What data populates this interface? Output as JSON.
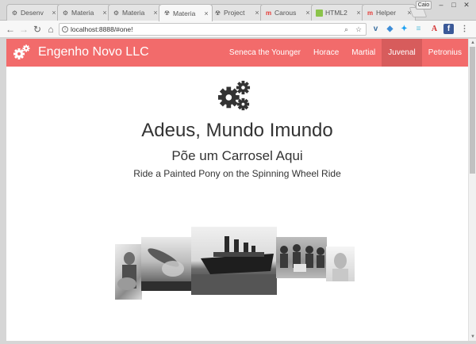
{
  "browser": {
    "tabs": [
      {
        "label": "Desenv",
        "icon": "gear-icon",
        "active": false
      },
      {
        "label": "Materia",
        "icon": "gear-icon",
        "active": false
      },
      {
        "label": "Materia",
        "icon": "gear-icon",
        "active": false
      },
      {
        "label": "Materia",
        "icon": "radiation-icon",
        "active": true
      },
      {
        "label": "Project",
        "icon": "radiation-icon",
        "active": false
      },
      {
        "label": "Carous",
        "icon": "brand-m-icon",
        "active": false
      },
      {
        "label": "HTML2",
        "icon": "html-doc-icon",
        "active": false
      },
      {
        "label": "Helper",
        "icon": "brand-m-icon",
        "active": false
      }
    ],
    "close_glyph": "×",
    "profile_label": "Caio",
    "address": "localhost:8888/#one!",
    "extensions": [
      "vimeo-icon",
      "dropbox-icon",
      "twitter-icon",
      "buffer-icon",
      "acrobat-icon",
      "facebook-icon"
    ]
  },
  "site": {
    "brand": "Engenho Novo LLC",
    "nav": [
      {
        "label": "Seneca the Younger",
        "active": false
      },
      {
        "label": "Horace",
        "active": false
      },
      {
        "label": "Martial",
        "active": false
      },
      {
        "label": "Juvenal",
        "active": true
      },
      {
        "label": "Petronius",
        "active": false
      }
    ],
    "headline": "Adeus, Mundo Imundo",
    "subheadline": "Põe um Carrosel Aqui",
    "tagline": "Ride a Painted Pony on the Spinning Wheel Ride",
    "carousel": [
      {
        "name": "guitarist-photo"
      },
      {
        "name": "hindenburg-photo"
      },
      {
        "name": "titanic-photo"
      },
      {
        "name": "beatles-photo"
      },
      {
        "name": "portrait-photo"
      }
    ]
  },
  "colors": {
    "navbar": "#f26b6b",
    "nav_active": "#d75c5c",
    "text": "#333333"
  }
}
